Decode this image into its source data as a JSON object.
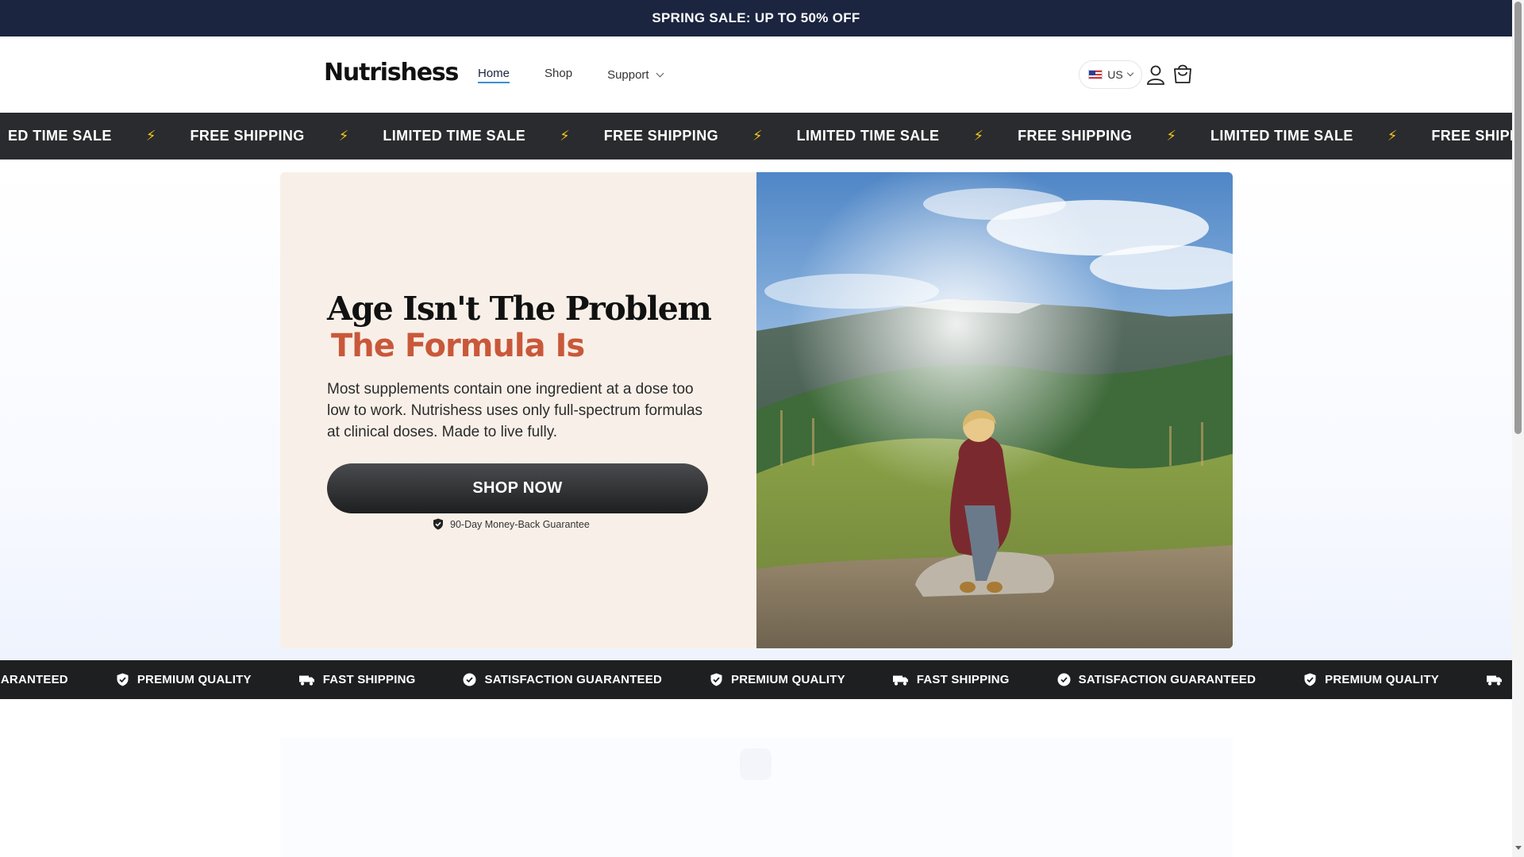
{
  "announcement": "SPRING SALE: UP TO 50% OFF",
  "header": {
    "logo": "Nutrishess",
    "nav": {
      "home": "Home",
      "shop": "Shop",
      "support": "Support"
    },
    "locale": "US"
  },
  "ticker": [
    "ED TIME SALE",
    "FREE SHIPPING",
    "LIMITED TIME SALE",
    "FREE SHIPPING",
    "LIMITED TIME SALE",
    "FREE SHIPPING",
    "LIMITED TIME SALE",
    "FREE SHIPPING"
  ],
  "ticker_separator": "⚡",
  "hero": {
    "headline": "Age Isn't The Problem",
    "subheadline": "The Formula Is",
    "body": "Most supplements contain one ingredient at a dose too low to work. Nutrishess uses only full-spectrum formulas at clinical doses. Made to live fully.",
    "cta": "SHOP NOW",
    "guarantee": "90-Day Money-Back Guarantee"
  },
  "trust_bar": [
    "GUARANTEED",
    "PREMIUM QUALITY",
    "FAST SHIPPING",
    "SATISFACTION GUARANTEED",
    "PREMIUM QUALITY",
    "FAST SHIPPING",
    "SATISFACTION GUARANTEED",
    "PREMIUM QUALITY"
  ],
  "colors": {
    "announcement_bg": "#1b2540",
    "accent": "#c9583a",
    "hero_panel_bg": "#f8f0e8",
    "ticker_bg": "#2a2b2e",
    "ticker_icon": "#f5c518"
  },
  "icons": {
    "user": "user-icon",
    "cart": "shopping-bag-icon",
    "separator": "lightning-bolt-icon",
    "guarantee": "shield-check-icon",
    "premium": "badge-check-icon",
    "shipping": "truck-icon",
    "satisfaction": "check-circle-icon"
  }
}
